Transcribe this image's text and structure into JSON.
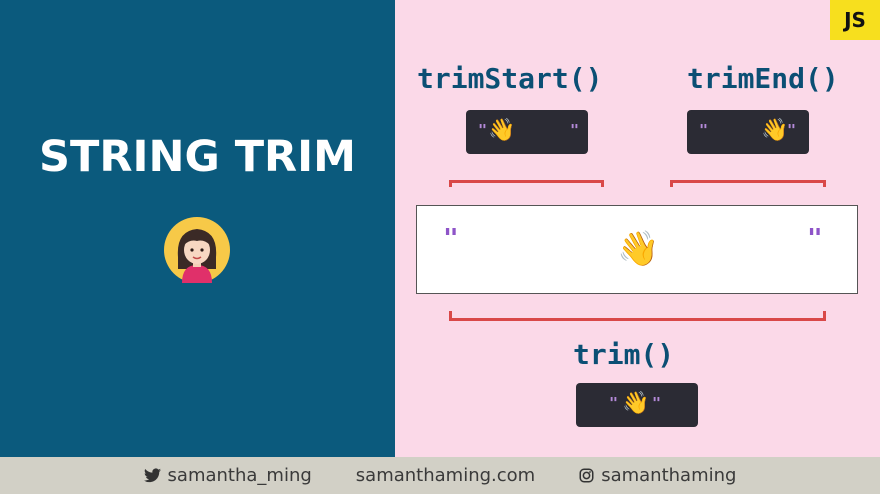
{
  "title": "STRING TRIM",
  "badge": "JS",
  "methods": {
    "trim_start": "trimStart()",
    "trim_end": "trimEnd()",
    "trim": "trim()"
  },
  "quote": "\"",
  "wave_emoji": "👋",
  "footer": {
    "twitter": "samantha_ming",
    "website": "samanthaming.com",
    "instagram": "samanthaming"
  },
  "colors": {
    "left_bg": "#0b5a7d",
    "right_bg": "#fbd9e8",
    "footer_bg": "#d2d0c6",
    "badge_bg": "#f7df1e",
    "bracket": "#d94848",
    "code_pill": "#2b2b34",
    "quote": "#8e54c8",
    "method_text": "#0b4f74"
  },
  "icons": [
    "twitter-icon",
    "instagram-icon",
    "avatar-icon",
    "wave-emoji"
  ]
}
